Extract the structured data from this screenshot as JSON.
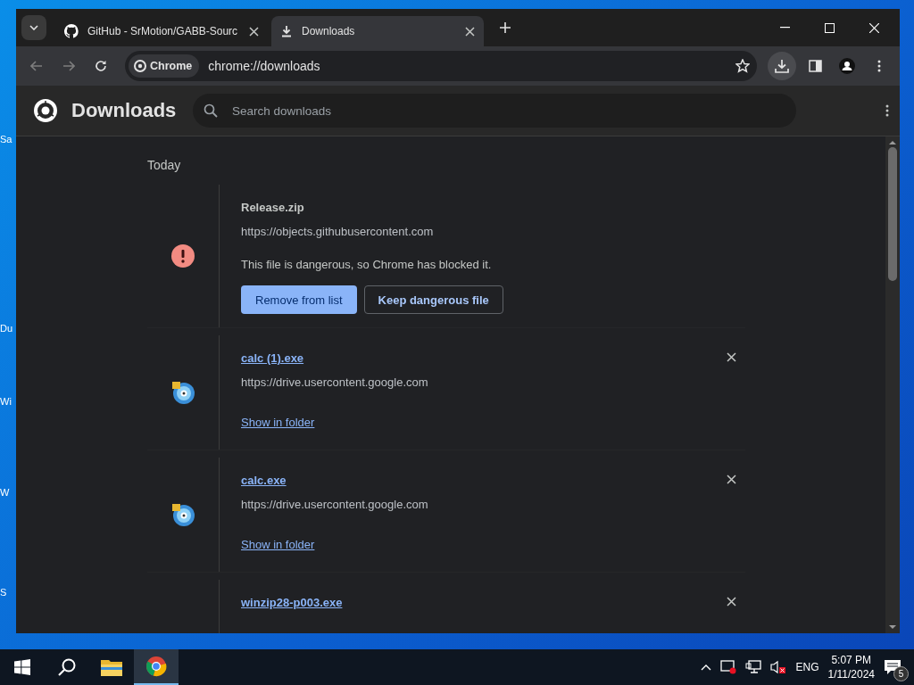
{
  "desktop_icons": [
    {
      "label": "Sa"
    },
    {
      "label": "Du"
    },
    {
      "label": "Wi"
    },
    {
      "label": "W"
    },
    {
      "label": "S"
    }
  ],
  "window": {
    "tabs": [
      {
        "title": "GitHub - SrMotion/GABB-Sourc",
        "kind": "github",
        "selected": false
      },
      {
        "title": "Downloads",
        "kind": "download",
        "selected": true
      }
    ],
    "chip": "Chrome",
    "address": "chrome://downloads"
  },
  "page": {
    "title": "Downloads",
    "search": {
      "placeholder": "Search downloads"
    },
    "date_heading": "Today",
    "items": [
      {
        "kind": "blocked",
        "name": "Release.zip",
        "url": "https://objects.githubusercontent.com",
        "message": "This file is dangerous, so Chrome has blocked it.",
        "buttons": [
          "Remove from list",
          "Keep dangerous file"
        ]
      },
      {
        "kind": "completed",
        "name": "calc (1).exe",
        "url": "https://drive.usercontent.google.com",
        "link": "Show in folder"
      },
      {
        "kind": "completed",
        "name": "calc.exe",
        "url": "https://drive.usercontent.google.com",
        "link": "Show in folder"
      },
      {
        "kind": "partial",
        "name": "winzip28-p003.exe"
      }
    ]
  },
  "taskbar": {
    "apps": [
      {
        "kind": "explorer",
        "selected": false
      },
      {
        "kind": "chrome",
        "selected": true
      }
    ],
    "language": "ENG",
    "time": "5:07 PM",
    "date": "1/11/2024",
    "notifications": "5"
  }
}
